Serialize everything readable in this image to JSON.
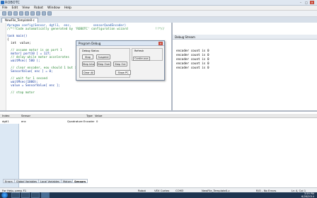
{
  "window": {
    "title": "ROBOTC"
  },
  "menu": [
    "File",
    "Edit",
    "View",
    "Robot",
    "Window",
    "Help"
  ],
  "file_tab": "NewFile_Template0-c",
  "code": [
    "#pragma config(Sensor, dgtl1,  enc,            sensorQuadEncoder)",
    "//*!!Code automatically generated by 'ROBOTC' configuration wizard               !!*//",
    "",
    "task main()",
    "{",
    "  int  value;",
    "",
    "  // assume motor is on port 1",
    "  motor[ port10 ] = 127;",
    "  // delay while motor accelerates",
    "  waitMsec( 500 );",
    "",
    "  // clear encoder, eou should 1 but it could also be a port issue",
    "  SensorValue[ enc ] = 0;",
    "",
    "  // wait for 1 second",
    "  waitMsec(1000);",
    "  value = SensorValue[ enc ];",
    "",
    "  // stop motor"
  ],
  "program_debug": {
    "title": "Program Debug",
    "status_label": "Debug Status",
    "refresh_label": "Refresh",
    "refresh_value": "Continuous",
    "buttons": {
      "stop": "Stop",
      "suspend": "Suspend",
      "step_into": "Step Into",
      "step_over": "Step Over",
      "step_out": "Step Out",
      "clear_all": "Clear All",
      "show_pc": "Show PC"
    }
  },
  "debug_stream": {
    "title": "Debug Stream",
    "lines": [
      "encoder count is 0",
      "encoder count is 0",
      "encoder count is 0",
      "encoder count is 0",
      "encoder count is 0"
    ]
  },
  "sensors_table": {
    "headers": [
      "Index",
      "Sensor",
      "Type",
      "Value"
    ],
    "row": {
      "index": "dgtl1",
      "sensor": "enc",
      "type": "Quadrature Encoder",
      "value": "0"
    }
  },
  "bottom_tabs": [
    "Errors",
    "Global Variables",
    "Local Variables",
    "Motors",
    "Sensors"
  ],
  "statusbar": {
    "help": "For Help, press F1",
    "robot": "Robot",
    "platform": "VEX Cortex",
    "port": "COM3",
    "file": "NewFile_Template0-c",
    "mode": "R/O - No Errors",
    "pos": "Ln 4, Col 1"
  },
  "clock": {
    "time": "3:59 PM",
    "date": "6/28/2014"
  }
}
